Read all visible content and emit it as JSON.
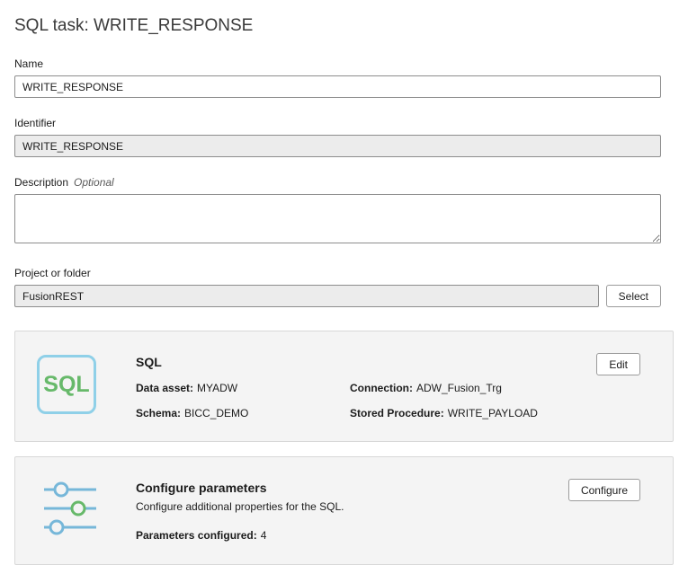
{
  "page": {
    "title": "SQL task: WRITE_RESPONSE"
  },
  "form": {
    "name": {
      "label": "Name",
      "value": "WRITE_RESPONSE"
    },
    "identifier": {
      "label": "Identifier",
      "value": "WRITE_RESPONSE"
    },
    "description": {
      "label": "Description",
      "optional": "Optional",
      "value": ""
    },
    "project": {
      "label": "Project or folder",
      "value": "FusionREST",
      "select_button": "Select"
    }
  },
  "cards": {
    "sql": {
      "icon_text": "SQL",
      "title": "SQL",
      "edit_button": "Edit",
      "fields": [
        {
          "label": "Data asset:",
          "value": "MYADW"
        },
        {
          "label": "Connection:",
          "value": "ADW_Fusion_Trg"
        },
        {
          "label": "Schema:",
          "value": "BICC_DEMO"
        },
        {
          "label": "Stored Procedure:",
          "value": "WRITE_PAYLOAD"
        }
      ]
    },
    "parameters": {
      "title": "Configure parameters",
      "description": "Configure additional properties for the SQL.",
      "configured_label": "Parameters configured:",
      "configured_value": "4",
      "configure_button": "Configure"
    }
  },
  "colors": {
    "sql_icon_border": "#8fd0e8",
    "sql_icon_text": "#67b96a",
    "sliders_line": "#76b7d9",
    "sliders_circle_green": "#67b96a",
    "card_background": "#f4f4f4"
  }
}
